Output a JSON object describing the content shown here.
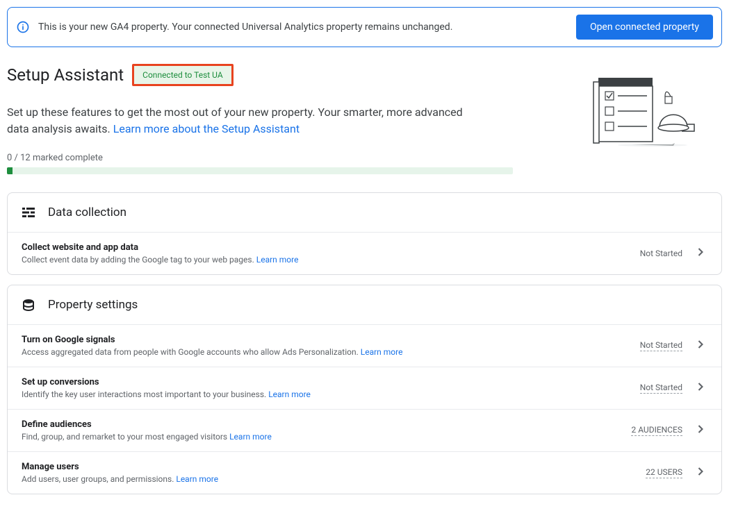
{
  "banner": {
    "text": "This is your new GA4 property. Your connected Universal Analytics property remains unchanged.",
    "button": "Open connected property"
  },
  "header": {
    "title": "Setup Assistant",
    "badge": "Connected to Test UA",
    "subtitle_pre": "Set up these features to get the most out of your new property. Your smarter, more advanced data analysis awaits. ",
    "subtitle_link": "Learn more about the Setup Assistant"
  },
  "progress": {
    "label": "0 / 12 marked complete"
  },
  "sections": [
    {
      "icon": "data-collection-icon",
      "title": "Data collection",
      "tasks": [
        {
          "title": "Collect website and app data",
          "desc": "Collect event data by adding the Google tag to your web pages. ",
          "link": "Learn more",
          "status": "Not Started",
          "status_style": "plain"
        }
      ]
    },
    {
      "icon": "property-settings-icon",
      "title": "Property settings",
      "tasks": [
        {
          "title": "Turn on Google signals",
          "desc": "Access aggregated data from people with Google accounts who allow Ads Personalization. ",
          "link": "Learn more",
          "status": "Not Started",
          "status_style": "dotted"
        },
        {
          "title": "Set up conversions",
          "desc": "Identify the key user interactions most important to your business. ",
          "link": "Learn more",
          "status": "Not Started",
          "status_style": "dotted"
        },
        {
          "title": "Define audiences",
          "desc": "Find, group, and remarket to your most engaged visitors ",
          "link": "Learn more",
          "status": "2 AUDIENCES",
          "status_style": "dotted"
        },
        {
          "title": "Manage users",
          "desc": "Add users, user groups, and permissions. ",
          "link": "Learn more",
          "status": "22 USERS",
          "status_style": "dotted"
        }
      ]
    }
  ]
}
